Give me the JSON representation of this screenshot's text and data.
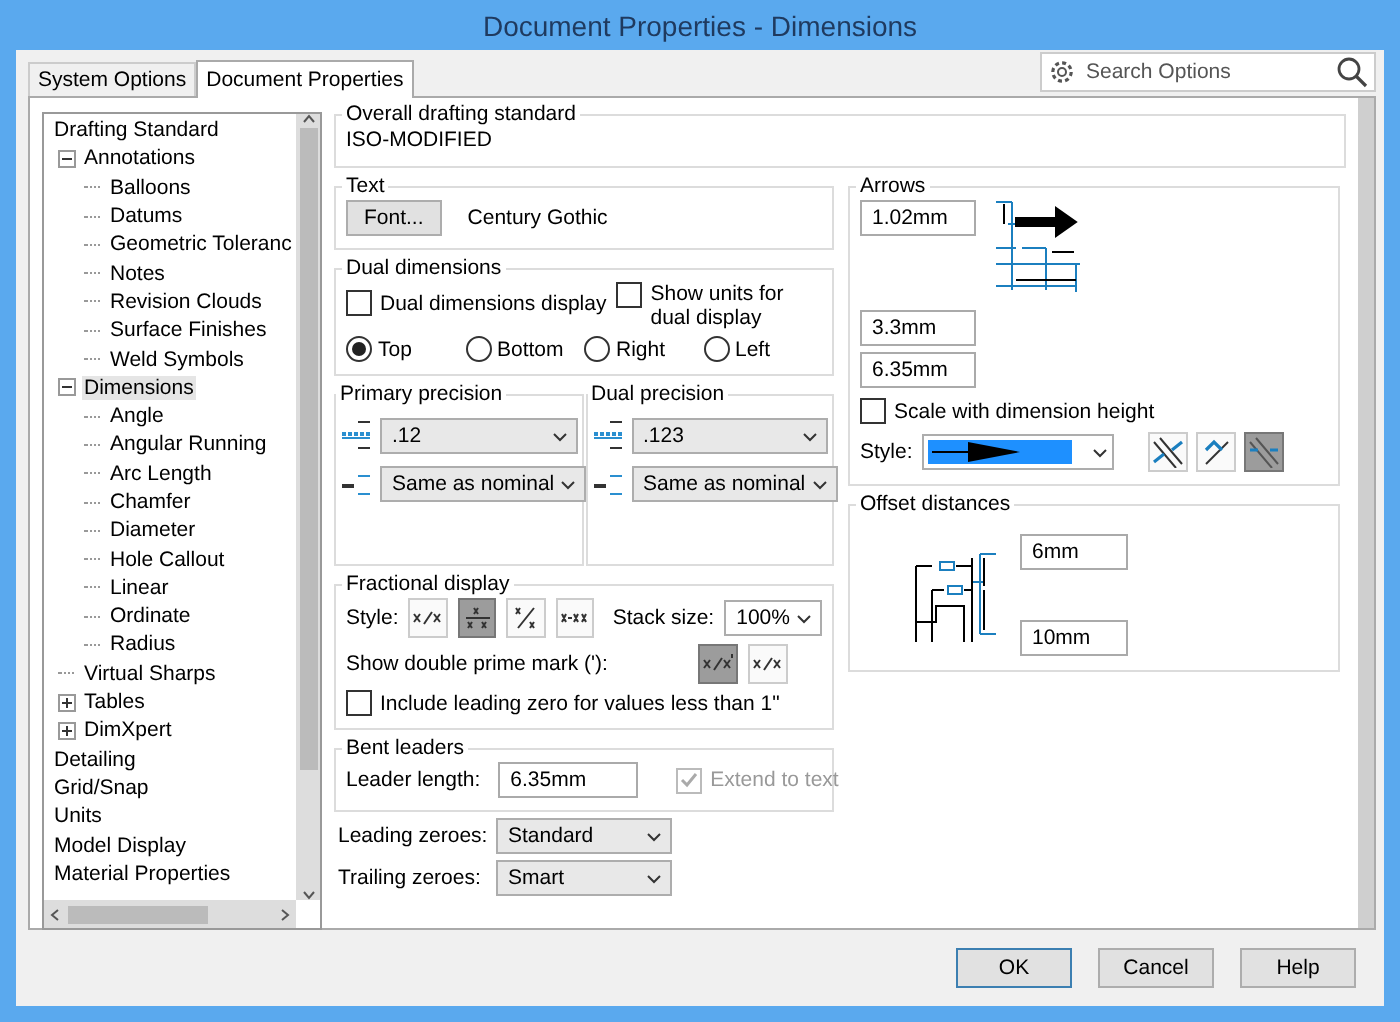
{
  "window": {
    "title": "Document Properties - Dimensions"
  },
  "tabs": [
    {
      "label": "System Options",
      "selected": false
    },
    {
      "label": "Document Properties",
      "selected": true
    }
  ],
  "search": {
    "placeholder": "Search Options"
  },
  "tree": {
    "items": [
      {
        "label": "Drafting Standard",
        "selected": false,
        "children": [
          {
            "label": "Annotations",
            "selected": false,
            "expanded": true,
            "children": [
              {
                "label": "Balloons",
                "selected": false
              },
              {
                "label": "Datums",
                "selected": false
              },
              {
                "label": "Geometric Toleranc",
                "selected": false
              },
              {
                "label": "Notes",
                "selected": false
              },
              {
                "label": "Revision Clouds",
                "selected": false
              },
              {
                "label": "Surface Finishes",
                "selected": false
              },
              {
                "label": "Weld Symbols",
                "selected": false
              }
            ]
          },
          {
            "label": "Dimensions",
            "selected": true,
            "expanded": true,
            "children": [
              {
                "label": "Angle",
                "selected": false
              },
              {
                "label": "Angular Running",
                "selected": false
              },
              {
                "label": "Arc Length",
                "selected": false
              },
              {
                "label": "Chamfer",
                "selected": false
              },
              {
                "label": "Diameter",
                "selected": false
              },
              {
                "label": "Hole Callout",
                "selected": false
              },
              {
                "label": "Linear",
                "selected": false
              },
              {
                "label": "Ordinate",
                "selected": false
              },
              {
                "label": "Radius",
                "selected": false
              }
            ]
          },
          {
            "label": "Virtual Sharps",
            "selected": false
          },
          {
            "label": "Tables",
            "selected": false,
            "expanded": false
          },
          {
            "label": "DimXpert",
            "selected": false,
            "expanded": false
          }
        ]
      },
      {
        "label": "Detailing",
        "selected": false
      },
      {
        "label": "Grid/Snap",
        "selected": false
      },
      {
        "label": "Units",
        "selected": false
      },
      {
        "label": "Model Display",
        "selected": false
      },
      {
        "label": "Material Properties",
        "selected": false
      }
    ]
  },
  "overall": {
    "title": "Overall drafting standard",
    "value": "ISO-MODIFIED"
  },
  "text": {
    "title": "Text",
    "button": "Font...",
    "font": "Century Gothic"
  },
  "dual": {
    "title": "Dual dimensions",
    "checks": [
      {
        "label": "Dual dimensions display",
        "checked": false
      },
      {
        "label": "Show units for dual display",
        "checked": false
      }
    ],
    "positions": [
      {
        "label": "Top",
        "selected": true
      },
      {
        "label": "Bottom",
        "selected": false
      },
      {
        "label": "Right",
        "selected": false
      },
      {
        "label": "Left",
        "selected": false
      }
    ]
  },
  "precision": [
    {
      "title": "Primary precision",
      "value": ".12",
      "tolerance": "Same as nominal"
    },
    {
      "title": "Dual precision",
      "value": ".123",
      "tolerance": "Same as nominal"
    }
  ],
  "fractional": {
    "title": "Fractional display",
    "style_label": "Style:",
    "styles": [
      {
        "kind": "slash",
        "selected": false
      },
      {
        "kind": "stacked",
        "selected": true
      },
      {
        "kind": "diagonal",
        "selected": false
      },
      {
        "kind": "dash",
        "selected": false
      }
    ],
    "stack_label": "Stack size:",
    "stack_value": "100%",
    "prime_label": "Show double prime mark ('):",
    "prime": [
      {
        "kind": "prime",
        "selected": true
      },
      {
        "kind": "slash",
        "selected": false
      }
    ],
    "leading_zero": {
      "label": "Include leading zero for values less than 1\"",
      "checked": false
    }
  },
  "bent": {
    "title": "Bent leaders",
    "label": "Leader length:",
    "value": "6.35mm",
    "extend": {
      "label": "Extend to text",
      "checked": true,
      "disabled": true
    }
  },
  "zeroes": [
    {
      "label": "Leading zeroes:",
      "value": "Standard"
    },
    {
      "label": "Trailing zeroes:",
      "value": "Smart"
    }
  ],
  "arrows": {
    "title": "Arrows",
    "sizes": [
      "1.02mm",
      "3.3mm",
      "6.35mm"
    ],
    "scale": {
      "label": "Scale with dimension height",
      "checked": false
    },
    "style_label": "Style:",
    "placement": [
      {
        "kind": "inside",
        "selected": false
      },
      {
        "kind": "outside",
        "selected": false
      },
      {
        "kind": "smart",
        "selected": true
      }
    ]
  },
  "offset": {
    "title": "Offset distances",
    "values": [
      "6mm",
      "10mm"
    ]
  },
  "buttons": [
    "OK",
    "Cancel",
    "Help"
  ]
}
